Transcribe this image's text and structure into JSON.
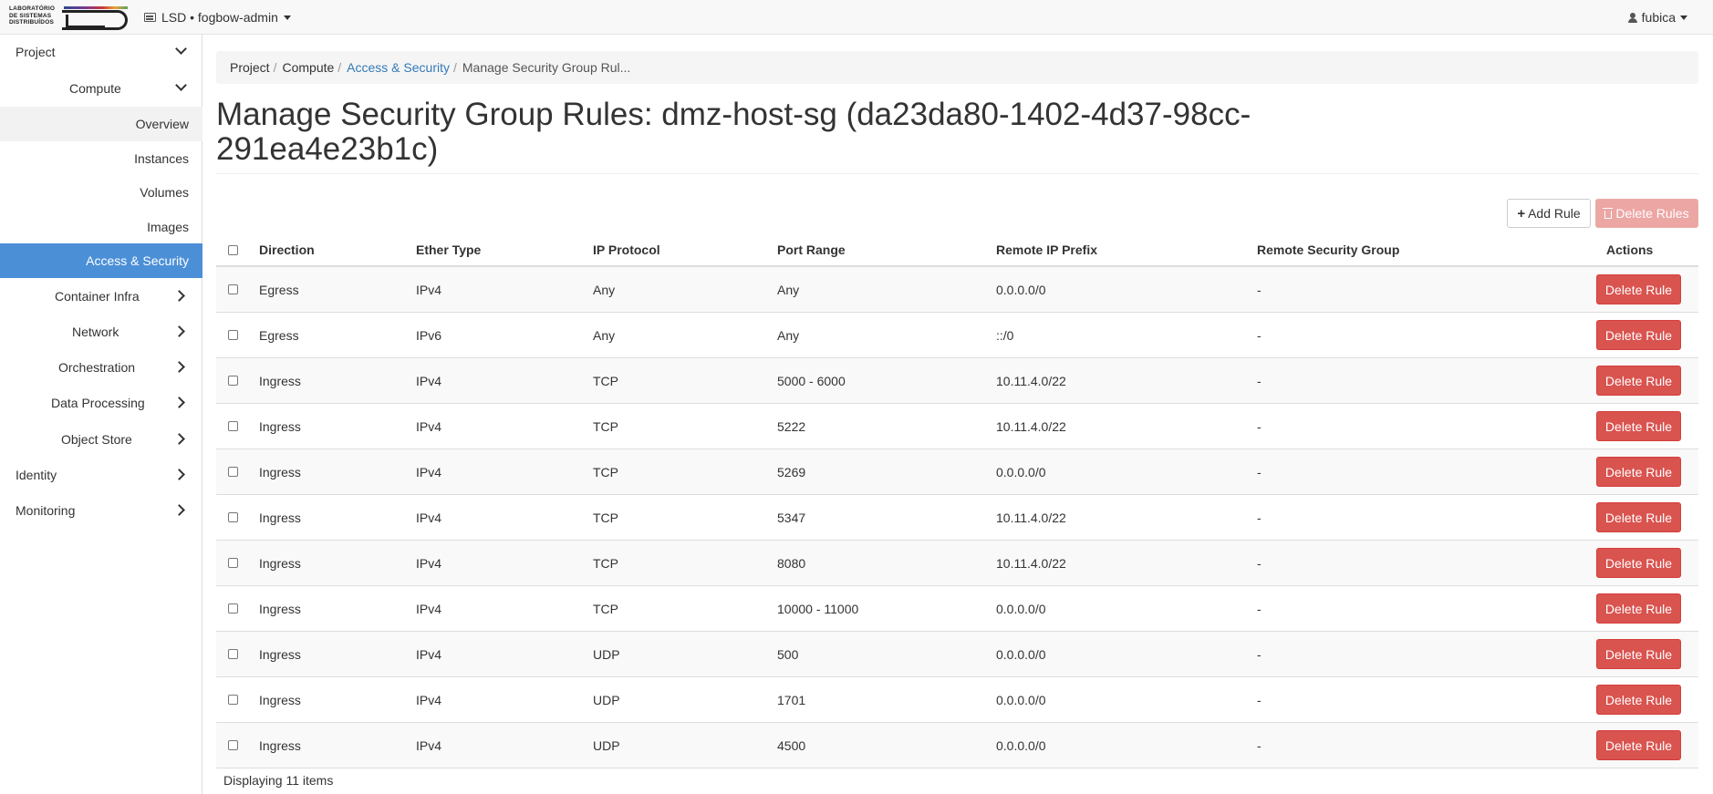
{
  "header": {
    "logo_text_line1": "LABORATÓRIO",
    "logo_text_line2": "DE SISTEMAS",
    "logo_text_line3": "DISTRIBUÍDOS",
    "project_selector": "LSD • fogbow-admin",
    "user": "fubica"
  },
  "sidebar": {
    "project": "Project",
    "compute": "Compute",
    "overview": "Overview",
    "instances": "Instances",
    "volumes": "Volumes",
    "images": "Images",
    "access_security": "Access & Security",
    "container_infra": "Container Infra",
    "network": "Network",
    "orchestration": "Orchestration",
    "data_processing": "Data Processing",
    "object_store": "Object Store",
    "identity": "Identity",
    "monitoring": "Monitoring"
  },
  "breadcrumb": {
    "project": "Project",
    "compute": "Compute",
    "access_security": "Access & Security",
    "current": "Manage Security Group Rul..."
  },
  "page": {
    "title": "Manage Security Group Rules: dmz-host-sg (da23da80-1402-4d37-98cc-291ea4e23b1c)",
    "add_rule": "Add Rule",
    "delete_rules": "Delete Rules"
  },
  "table": {
    "headers": {
      "direction": "Direction",
      "ether_type": "Ether Type",
      "ip_protocol": "IP Protocol",
      "port_range": "Port Range",
      "remote_ip_prefix": "Remote IP Prefix",
      "remote_security_group": "Remote Security Group",
      "actions": "Actions"
    },
    "delete_label": "Delete Rule",
    "rows": [
      {
        "direction": "Egress",
        "ether_type": "IPv4",
        "ip_protocol": "Any",
        "port_range": "Any",
        "remote_ip_prefix": "0.0.0.0/0",
        "remote_sg": "-"
      },
      {
        "direction": "Egress",
        "ether_type": "IPv6",
        "ip_protocol": "Any",
        "port_range": "Any",
        "remote_ip_prefix": "::/0",
        "remote_sg": "-"
      },
      {
        "direction": "Ingress",
        "ether_type": "IPv4",
        "ip_protocol": "TCP",
        "port_range": "5000 - 6000",
        "remote_ip_prefix": "10.11.4.0/22",
        "remote_sg": "-"
      },
      {
        "direction": "Ingress",
        "ether_type": "IPv4",
        "ip_protocol": "TCP",
        "port_range": "5222",
        "remote_ip_prefix": "10.11.4.0/22",
        "remote_sg": "-"
      },
      {
        "direction": "Ingress",
        "ether_type": "IPv4",
        "ip_protocol": "TCP",
        "port_range": "5269",
        "remote_ip_prefix": "0.0.0.0/0",
        "remote_sg": "-"
      },
      {
        "direction": "Ingress",
        "ether_type": "IPv4",
        "ip_protocol": "TCP",
        "port_range": "5347",
        "remote_ip_prefix": "10.11.4.0/22",
        "remote_sg": "-"
      },
      {
        "direction": "Ingress",
        "ether_type": "IPv4",
        "ip_protocol": "TCP",
        "port_range": "8080",
        "remote_ip_prefix": "10.11.4.0/22",
        "remote_sg": "-"
      },
      {
        "direction": "Ingress",
        "ether_type": "IPv4",
        "ip_protocol": "TCP",
        "port_range": "10000 - 11000",
        "remote_ip_prefix": "0.0.0.0/0",
        "remote_sg": "-"
      },
      {
        "direction": "Ingress",
        "ether_type": "IPv4",
        "ip_protocol": "UDP",
        "port_range": "500",
        "remote_ip_prefix": "0.0.0.0/0",
        "remote_sg": "-"
      },
      {
        "direction": "Ingress",
        "ether_type": "IPv4",
        "ip_protocol": "UDP",
        "port_range": "1701",
        "remote_ip_prefix": "0.0.0.0/0",
        "remote_sg": "-"
      },
      {
        "direction": "Ingress",
        "ether_type": "IPv4",
        "ip_protocol": "UDP",
        "port_range": "4500",
        "remote_ip_prefix": "0.0.0.0/0",
        "remote_sg": "-"
      }
    ],
    "footer": "Displaying 11 items"
  },
  "colors": {
    "active_sidebar": "#4b8fd7",
    "danger": "#d9534f",
    "danger_disabled": "#eba2a0",
    "link": "#337ab7"
  }
}
